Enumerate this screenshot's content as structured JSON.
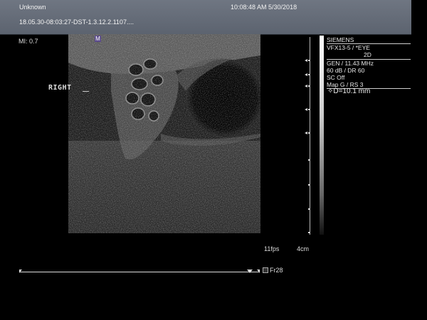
{
  "header": {
    "patient": "Unknown",
    "datetime": "10:08:48 AM 5/30/2018",
    "study_id": "18.05.30-08:03:27-DST-1.3.12.2.1107...."
  },
  "mi_label": "MI: 0.7",
  "side_label": "RIGHT",
  "probe_marker": "M",
  "panel": {
    "vendor": "SIEMENS",
    "probe": "VFX13-5 / *EYE",
    "mode": "2D",
    "frequency": "GEN / 11.43 MHz",
    "gain": "60 dB / DR 60",
    "sc": "SC Off",
    "map": "Map G / RS 3"
  },
  "measurement": "✧D=10.1 mm",
  "fps": "11fps",
  "depth": "4cm",
  "frame": "Fr28",
  "colors": {
    "header": "#666d78",
    "background": "#000000"
  }
}
